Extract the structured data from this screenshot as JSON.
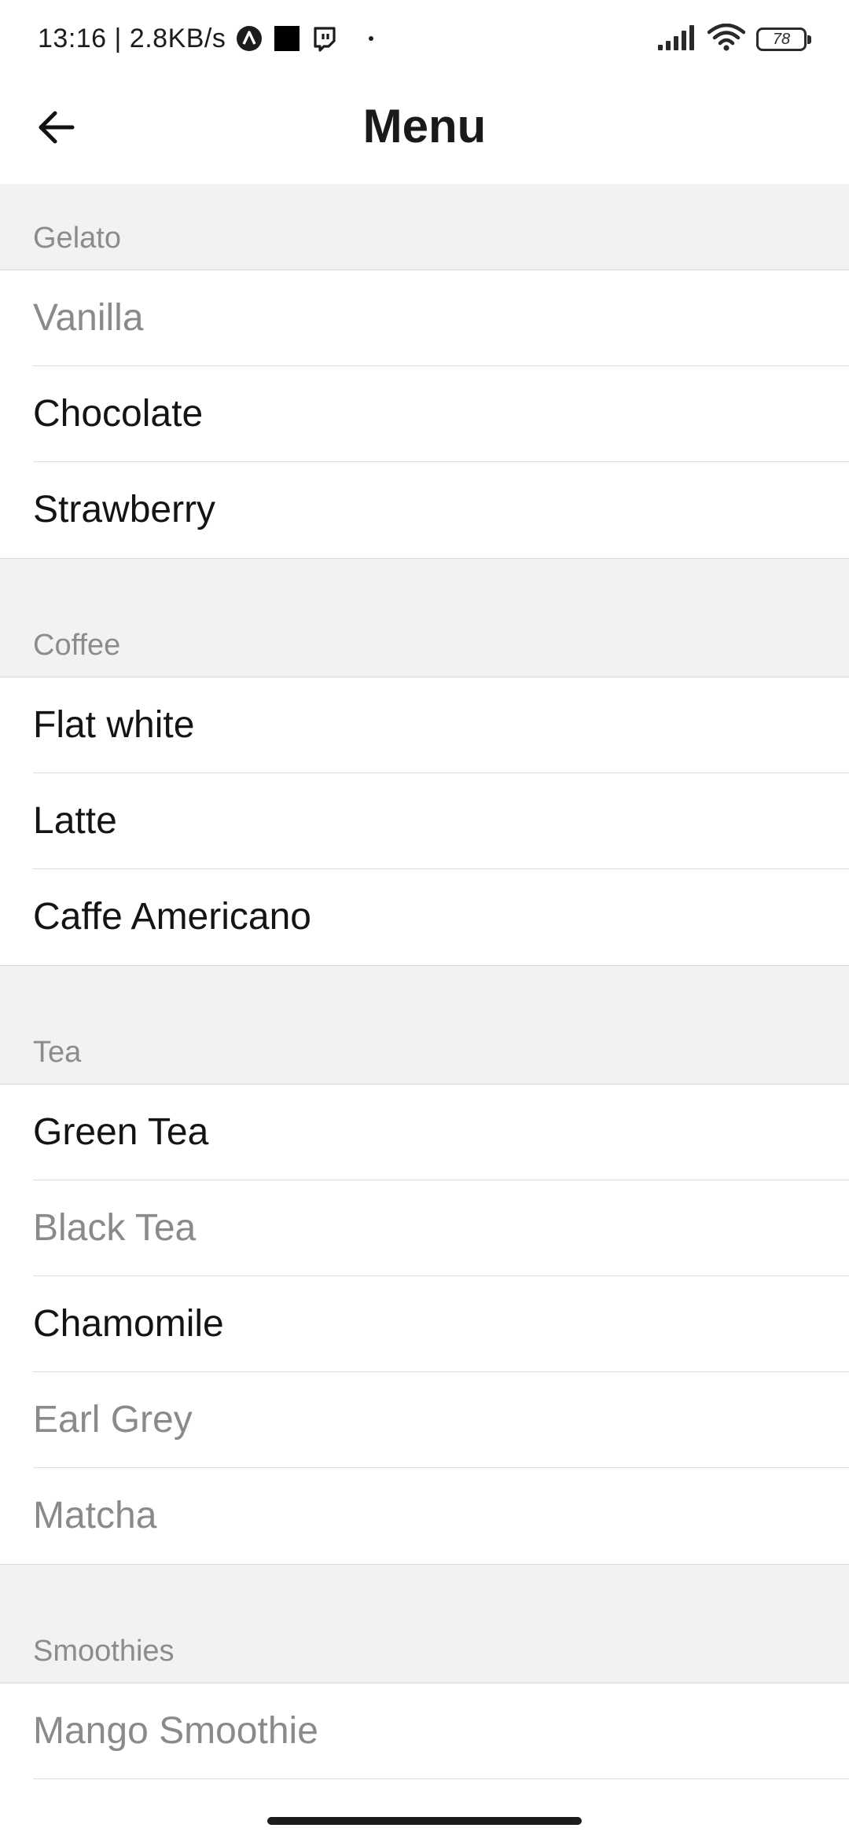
{
  "status_bar": {
    "time_speed": "13:16 | 2.8KB/s",
    "battery": "78",
    "icons": [
      "app-a-icon",
      "black-square-icon",
      "twitch-icon",
      "dot-icon",
      "signal-icon",
      "wifi-icon",
      "battery-icon"
    ]
  },
  "app_bar": {
    "title": "Menu",
    "back_icon": "arrow-left-icon"
  },
  "sections": [
    {
      "label": "Gelato",
      "items": [
        {
          "label": "Vanilla",
          "enabled": false
        },
        {
          "label": "Chocolate",
          "enabled": true
        },
        {
          "label": "Strawberry",
          "enabled": true
        }
      ]
    },
    {
      "label": "Coffee",
      "items": [
        {
          "label": "Flat white",
          "enabled": true
        },
        {
          "label": "Latte",
          "enabled": true
        },
        {
          "label": "Caffe Americano",
          "enabled": true
        }
      ]
    },
    {
      "label": "Tea",
      "items": [
        {
          "label": "Green Tea",
          "enabled": true
        },
        {
          "label": "Black Tea",
          "enabled": false
        },
        {
          "label": "Chamomile",
          "enabled": true
        },
        {
          "label": "Earl Grey",
          "enabled": false
        },
        {
          "label": "Matcha",
          "enabled": false
        }
      ]
    },
    {
      "label": "Smoothies",
      "items": [
        {
          "label": "Mango Smoothie",
          "enabled": false
        }
      ]
    }
  ],
  "colors": {
    "section_bg": "#f2f2f2",
    "section_label": "#8c8c8c",
    "item_enabled": "#141414",
    "item_disabled": "#8a8a8a",
    "divider": "#dcdcdc"
  }
}
